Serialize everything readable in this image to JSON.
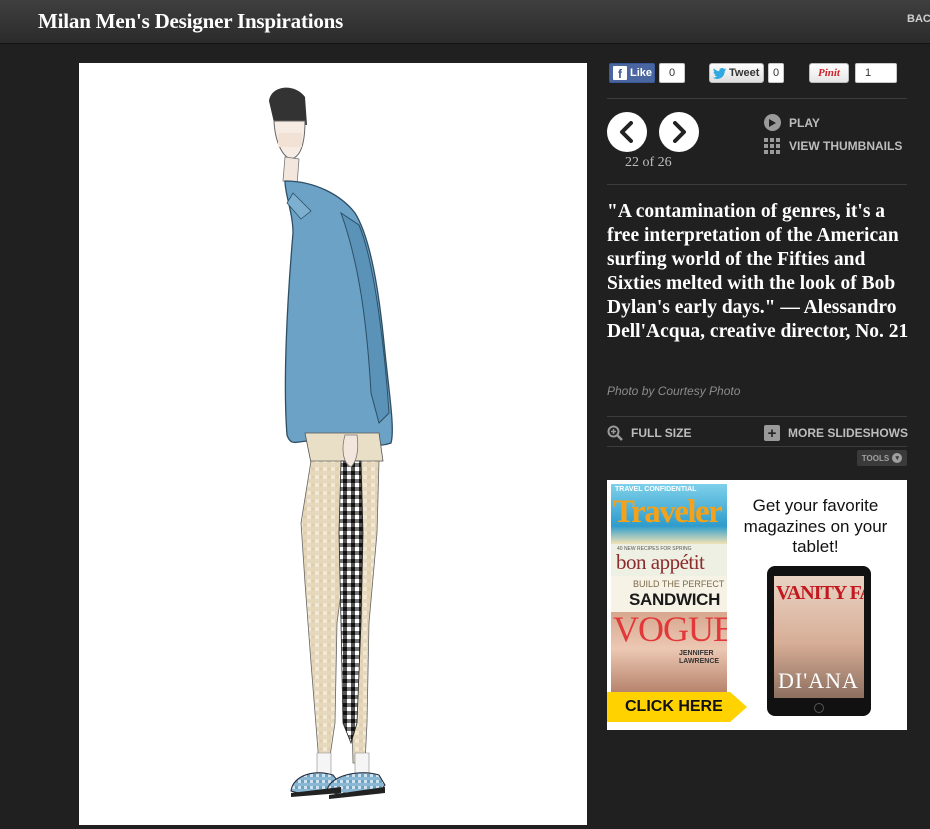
{
  "header": {
    "title": "Milan Men's Designer Inspirations",
    "back_label": "BAC"
  },
  "slide": {
    "image_alt": "Fashion sketch of a man in a blue shirt and checked trousers"
  },
  "social": {
    "like_label": "Like",
    "like_count": "0",
    "tweet_label": "Tweet",
    "tweet_count": "0",
    "pin_label": "Pinit",
    "pin_count": "1"
  },
  "nav": {
    "counter": "22 of 26",
    "play_label": "PLAY",
    "thumbnails_label": "VIEW THUMBNAILS"
  },
  "caption": {
    "text": "\"A contamination of genres, it's a free interpretation of the American surfing world of the Fifties and Sixties melted with the look of Bob Dylan's early days.\" — Alessandro Dell'Acqua, creative director, No. 21",
    "credit": "Photo by Courtesy Photo"
  },
  "tools": {
    "full_size_label": "FULL SIZE",
    "more_slideshows_label": "MORE SLIDESHOWS",
    "tools_label": "TOOLS"
  },
  "ad": {
    "headline": "Get your favorite magazines on your tablet!",
    "cta": "CLICK HERE",
    "mag1_kicker": "TRAVEL CONFIDENTIAL",
    "mag1_title": "Traveler",
    "mag2_kicker": "40 NEW RECIPES FOR SPRING",
    "mag2_title": "bon appétit",
    "mag3_kicker": "BUILD THE PERFECT",
    "mag3_title": "SANDWICH",
    "mag4_title": "VOGUE",
    "mag4_cover": "JENNIFER LAWRENCE",
    "tablet_title": "VANITY FAIR",
    "tablet_cover": "DI'ANA"
  },
  "colors": {
    "background": "#202020",
    "header": "#333333",
    "facebook": "#3b5998",
    "cta_yellow": "#ffd200"
  }
}
